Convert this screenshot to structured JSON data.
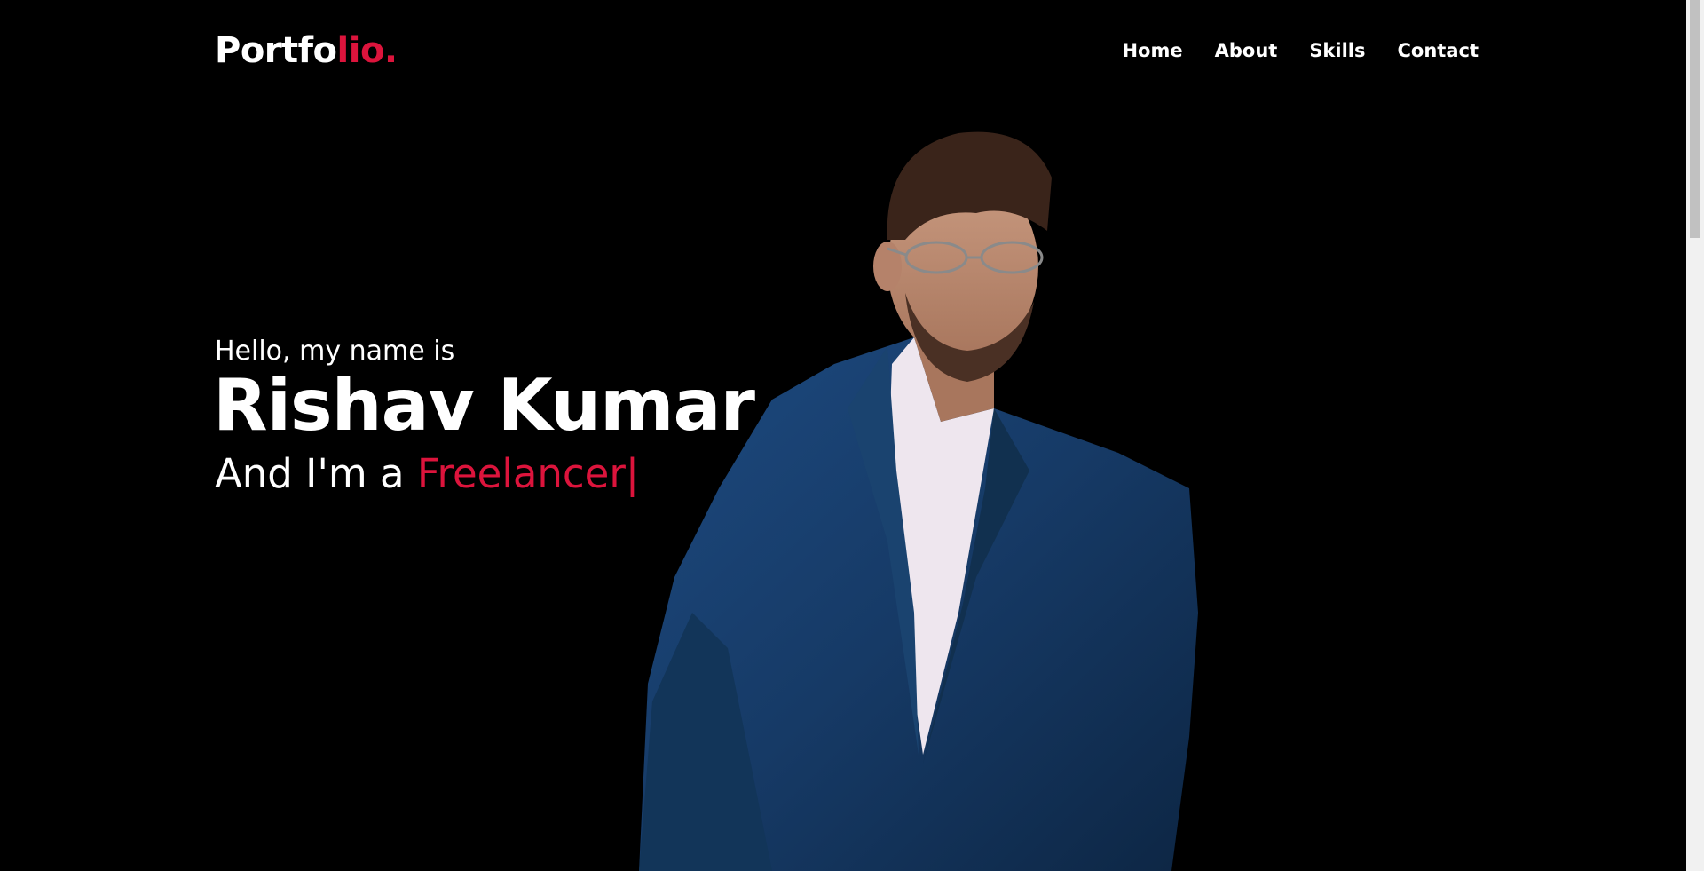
{
  "nav": {
    "logo_main": "Portfo",
    "logo_accent": "lio.",
    "links": [
      "Home",
      "About",
      "Skills",
      "Contact"
    ]
  },
  "hero": {
    "greeting": "Hello, my name is",
    "name": "Rishav Kumar",
    "role_prefix": "And I'm a ",
    "role": "Freelancer",
    "cursor": "|"
  },
  "colors": {
    "accent": "#dc143c",
    "background": "#000000",
    "text": "#ffffff"
  }
}
